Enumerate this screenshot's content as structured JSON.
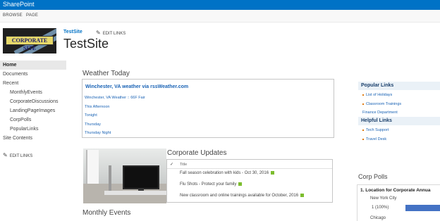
{
  "suite": {
    "brand": "SharePoint"
  },
  "ribbon": {
    "tabs": [
      "BROWSE",
      "PAGE"
    ]
  },
  "logo": {
    "text": "CORPORATE SITE"
  },
  "header": {
    "breadcrumb": "TestSite",
    "edit_links": "EDIT LINKS",
    "title": "TestSite"
  },
  "quicklaunch": {
    "items": [
      {
        "label": "Home",
        "selected": true
      },
      {
        "label": "Documents"
      },
      {
        "label": "Recent"
      },
      {
        "label": "MonthlyEvents",
        "indent": true
      },
      {
        "label": "CorporateDiscussions",
        "indent": true
      },
      {
        "label": "LandingPageImages",
        "indent": true
      },
      {
        "label": "CorpPolls",
        "indent": true
      },
      {
        "label": "PopularLinks",
        "indent": true
      },
      {
        "label": "Site Contents"
      }
    ],
    "edit_links": "EDIT LINKS"
  },
  "weather": {
    "heading": "Weather Today",
    "title": "Winchester, VA weather via rssWeather.com",
    "lines": [
      "Winchester, VA Weather :: 66F Fair",
      "This Afternoon",
      "Tonight",
      "Thursday",
      "Thursday Night"
    ]
  },
  "updates": {
    "heading": "Corporate Updates",
    "column": "Title",
    "rows": [
      "Fall season celebration with kids - Oct 30, 2016",
      "Flu Shots - Protect your family",
      "New classroom and online trainings available for October, 2016"
    ]
  },
  "events": {
    "heading": "Monthly Events"
  },
  "links": {
    "popular_heading": "Popular Links",
    "popular": [
      "List of Holidays",
      "Classroom Trainings",
      "Finance Department"
    ],
    "helpful_heading": "Helpful Links",
    "helpful": [
      "Tech Support",
      "Travel Desk"
    ]
  },
  "polls": {
    "heading": "Corp Polls",
    "question": "1. Location for Corporate Annua",
    "options": [
      {
        "name": "New York City",
        "result": "1 (100%)",
        "fraction": 1.0
      },
      {
        "name": "Chicago"
      }
    ]
  },
  "colors": {
    "suite": "#0072c6",
    "link": "#1a63b5",
    "new_badge": "#7cbd2e",
    "poll_bar": "#4472c4"
  }
}
